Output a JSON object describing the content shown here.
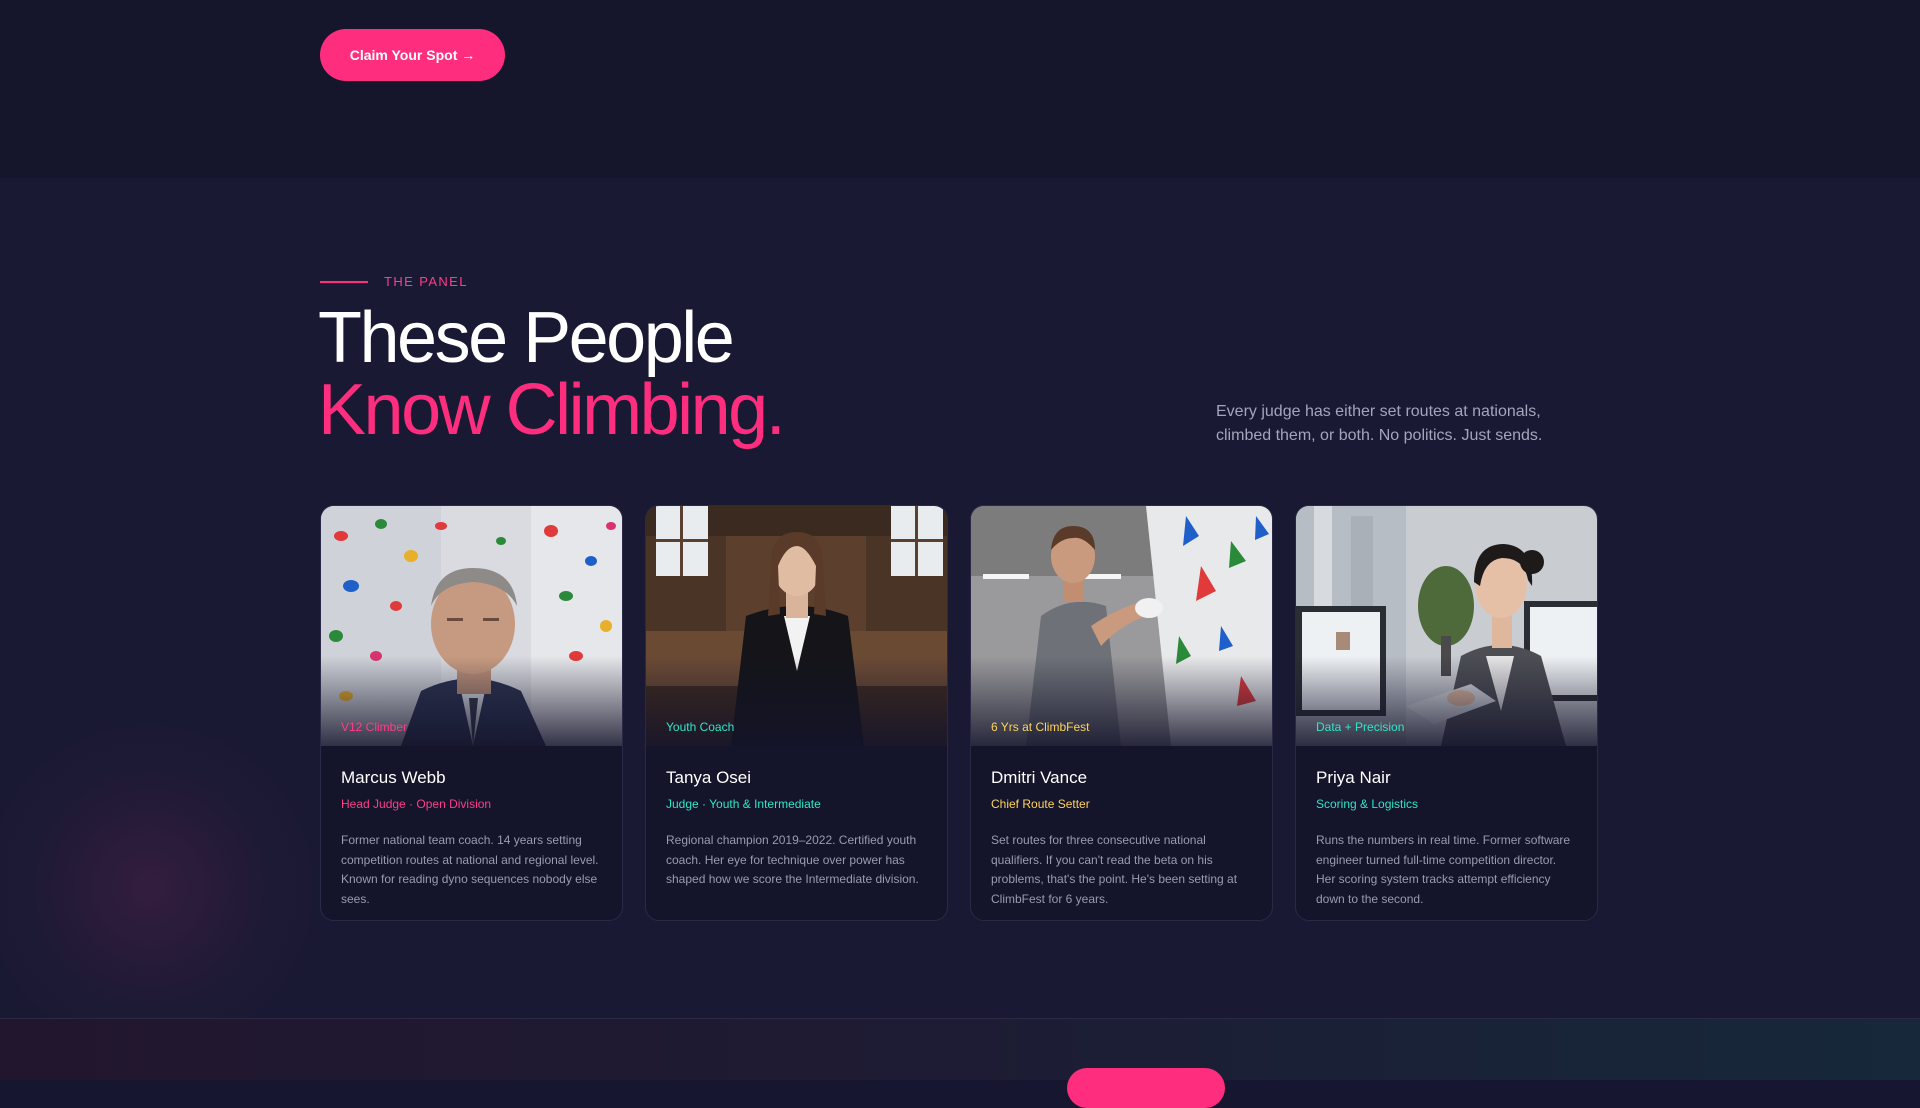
{
  "top": {
    "cta_label": "Claim Your Spot →"
  },
  "panel": {
    "eyebrow": "THE PANEL",
    "headline_line1": "These People",
    "headline_line2": "Know Climbing.",
    "intro": "Every judge has either set routes at nationals, climbed them, or both. No politics. Just sends.",
    "accent_color": "#ff2d7e",
    "judges": [
      {
        "tag": "V12 Climber",
        "name": "Marcus Webb",
        "role": "Head Judge · Open Division",
        "bio": "Former national team coach. 14 years setting competition routes at national and regional level. Known for reading dyno sequences nobody else sees.",
        "color": "#ff3d8a"
      },
      {
        "tag": "Youth Coach",
        "name": "Tanya Osei",
        "role": "Judge · Youth & Intermediate",
        "bio": "Regional champion 2019–2022. Certified youth coach. Her eye for technique over power has shaped how we score the Intermediate division.",
        "color": "#2ee6c8"
      },
      {
        "tag": "6 Yrs at ClimbFest",
        "name": "Dmitri Vance",
        "role": "Chief Route Setter",
        "bio": "Set routes for three consecutive national qualifiers. If you can't read the beta on his problems, that's the point. He's been setting at ClimbFest for 6 years.",
        "color": "#ffd45a"
      },
      {
        "tag": "Data + Precision",
        "name": "Priya Nair",
        "role": "Scoring & Logistics",
        "bio": "Runs the numbers in real time. Former software engineer turned full-time competition director. Her scoring system tracks attempt efficiency down to the second.",
        "color": "#2ee6c8"
      }
    ]
  }
}
